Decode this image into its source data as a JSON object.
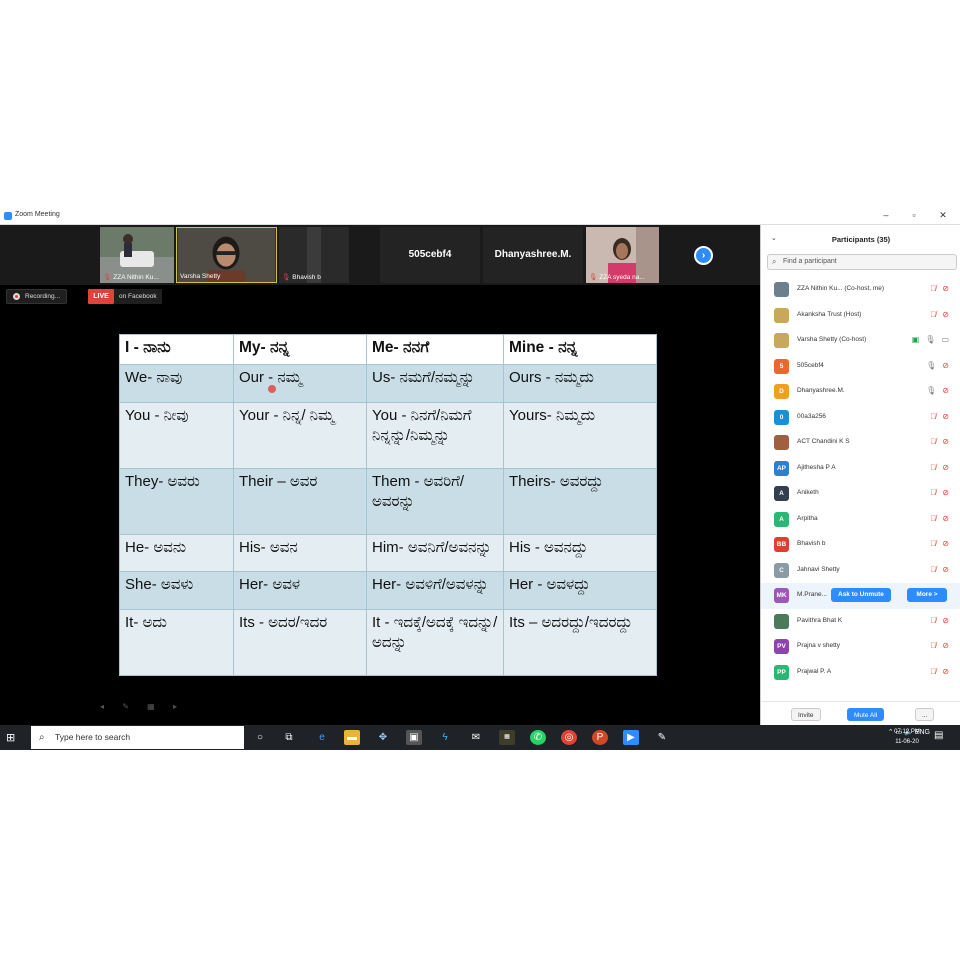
{
  "window": {
    "title": "Zoom Meeting"
  },
  "video_tiles": [
    {
      "name": "ZZA Nithin Ku...",
      "muted": true
    },
    {
      "name": "Varsha Shetty",
      "muted": false
    },
    {
      "name": "Bhavish b",
      "muted": true
    },
    {
      "name": "505cebf4",
      "muted": false
    },
    {
      "name": "Dhanyashree.M.",
      "muted": false
    },
    {
      "name": "ZZA syeda na...",
      "muted": true
    }
  ],
  "status": {
    "recording": "Recording...",
    "live": "LIVE",
    "live_target": "on Facebook"
  },
  "slide": {
    "headers": [
      "I - ನಾನು",
      "My- ನನ್ನ",
      "Me- ನನಗೆ",
      "Mine - ನನ್ನ"
    ],
    "rows": [
      [
        "We- ನಾವು",
        "Our - ನಮ್ಮ",
        "Us- ನಮಗೆ/ನಮ್ಮನ್ನು",
        "Ours - ನಮ್ಮದು"
      ],
      [
        "You - ನೀವು",
        "Your - ನಿನ್ನ/ ನಿಮ್ಮ",
        "You - ನಿನಗೆ/ನಿಮಗೆ ನಿನ್ನನ್ನು/ನಿಮ್ಮನ್ನು",
        "Yours- ನಿಮ್ಮದು"
      ],
      [
        "They- ಅವರು",
        "Their – ಅವರ",
        "Them - ಅವರಿಗೆ/ಅವರನ್ನು",
        "Theirs- ಅವರದ್ದು"
      ],
      [
        "He- ಅವನು",
        "His- ಅವನ",
        "Him- ಅವನಿಗೆ/ಅವನನ್ನು",
        "His - ಅವನದ್ದು"
      ],
      [
        "She- ಅವಳು",
        "Her- ಅವಳ",
        "Her- ಅವಳಿಗೆ/ಅವಳನ್ನು",
        "Her - ಅವಳದ್ದು"
      ],
      [
        "It- ಅದು",
        "Its - ಅದರ/ಇದರ",
        "It - ಇದಕ್ಕೆ/ಅದಕ್ಕೆ ಇದನ್ನು/ಅದನ್ನು",
        "Its – ಅದರದ್ದು/ಇದರದ್ದು"
      ]
    ]
  },
  "panel": {
    "title": "Participants (35)",
    "search_placeholder": "Find a participant",
    "participants": [
      {
        "name": "ZZA Nithin Ku...  (Co-host, me)",
        "initials": "",
        "color": "#6b7f8c",
        "icons": [
          "mic-off",
          "video-off"
        ]
      },
      {
        "name": "Akanksha Trust (Host)",
        "initials": "",
        "color": "#c8a85a",
        "icons": [
          "mic-off",
          "video-off"
        ]
      },
      {
        "name": "Varsha Shetty (Co-host)",
        "initials": "",
        "color": "#c8a85a",
        "icons": [
          "share",
          "mic-on",
          "video-on"
        ]
      },
      {
        "name": "505cebf4",
        "initials": "5",
        "color": "#e8692c",
        "icons": [
          "mic-on",
          "video-off"
        ]
      },
      {
        "name": "Dhanyashree.M.",
        "initials": "D",
        "color": "#f0a020",
        "icons": [
          "mic-on",
          "video-off"
        ]
      },
      {
        "name": "00a3a256",
        "initials": "0",
        "color": "#1a8fd6",
        "icons": [
          "mic-off",
          "video-off"
        ]
      },
      {
        "name": "ACT Chandini K S",
        "initials": "",
        "color": "#a06040",
        "icons": [
          "mic-off",
          "video-off"
        ]
      },
      {
        "name": "Ajithesha P A",
        "initials": "AP",
        "color": "#2e7fd0",
        "icons": [
          "mic-off",
          "video-off"
        ]
      },
      {
        "name": "Aniketh",
        "initials": "A",
        "color": "#333f4c",
        "icons": [
          "mic-off",
          "video-off"
        ]
      },
      {
        "name": "Arpitha",
        "initials": "A",
        "color": "#2bb673",
        "icons": [
          "mic-off",
          "video-off"
        ]
      },
      {
        "name": "Bhavish b",
        "initials": "BB",
        "color": "#d9422e",
        "icons": [
          "mic-off",
          "video-off"
        ]
      },
      {
        "name": "Jahnavi Shetty",
        "initials": "C",
        "color": "#8a9ba6",
        "icons": [
          "mic-off",
          "video-off"
        ]
      },
      {
        "name": "M.Prane...",
        "initials": "MK",
        "color": "#9b59b6",
        "icons": []
      },
      {
        "name": "Pavithra Bhat K",
        "initials": "",
        "color": "#4a7a5a",
        "icons": [
          "mic-off",
          "video-off"
        ]
      },
      {
        "name": "Prajna v shetty",
        "initials": "PV",
        "color": "#8e44ad",
        "icons": [
          "mic-off",
          "video-off"
        ]
      },
      {
        "name": "Prajwal P. A",
        "initials": "PP",
        "color": "#2bb673",
        "icons": [
          "mic-off",
          "video-off"
        ]
      }
    ],
    "ask_to_unmute": "Ask to Unmute",
    "more": "More >",
    "invite": "Invite",
    "mute_all": "Mute All",
    "overflow": "..."
  },
  "taskbar": {
    "search_placeholder": "Type here to search",
    "lang": "ENG",
    "time": "07:12 PM",
    "date": "11-06-20"
  }
}
